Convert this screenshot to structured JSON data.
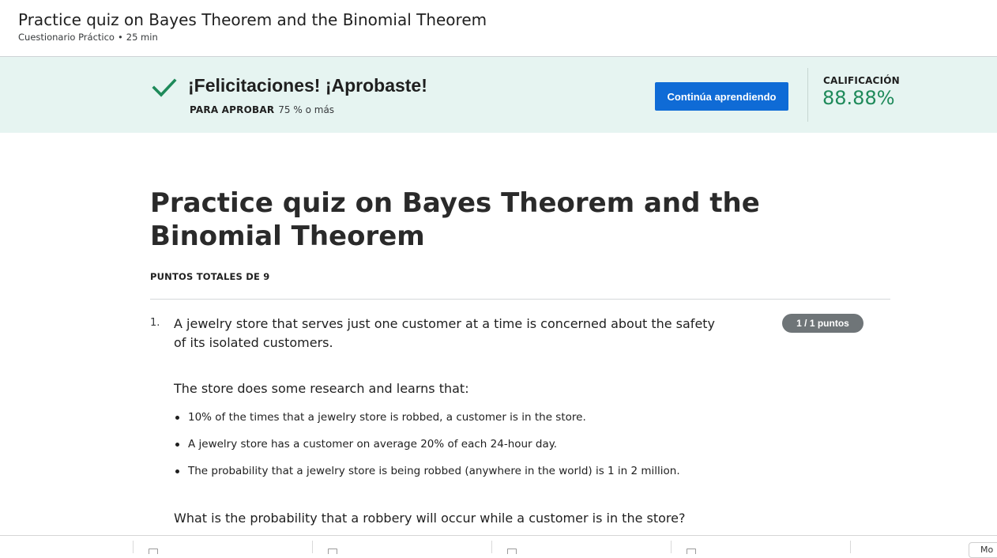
{
  "header": {
    "title": "Practice quiz on Bayes Theorem and the Binomial Theorem",
    "type": "Cuestionario Práctico",
    "separator": "•",
    "duration": "25 min"
  },
  "banner": {
    "message": "¡Felicitaciones! ¡Aprobaste!",
    "pass_label": "PARA APROBAR",
    "pass_value": "75 % o más",
    "continue_label": "Continúa aprendiendo",
    "grade_label": "CALIFICACIÓN",
    "grade_value": "88.88%",
    "colors": {
      "background": "#e6f4f1",
      "check": "#1e8a5a",
      "grade": "#1e8a5a",
      "button": "#0f6bd6"
    }
  },
  "quiz": {
    "title": "Practice quiz on Bayes Theorem and the Binomial Theorem",
    "points_total_label": "PUNTOS TOTALES DE 9"
  },
  "question1": {
    "number": "1.",
    "text": "A jewelry store that serves just one customer at a time is concerned about the safety of its isolated customers.",
    "points": "1 / 1 puntos",
    "research_intro": "The store does some research and learns that:",
    "bullets": [
      "10% of the times that a jewelry store is robbed, a customer is in the store.",
      "A jewelry store has a customer on average 20% of each 24-hour day.",
      "The probability that a jewelry store is being robbed (anywhere in the world) is 1 in 2 million."
    ],
    "ask": "What is the probability that a robbery will occur while a customer is in the store?"
  },
  "shelf": {
    "icons": [
      "file-icon",
      "file-icon",
      "file-icon",
      "file-icon"
    ],
    "more_label": "Mo"
  }
}
